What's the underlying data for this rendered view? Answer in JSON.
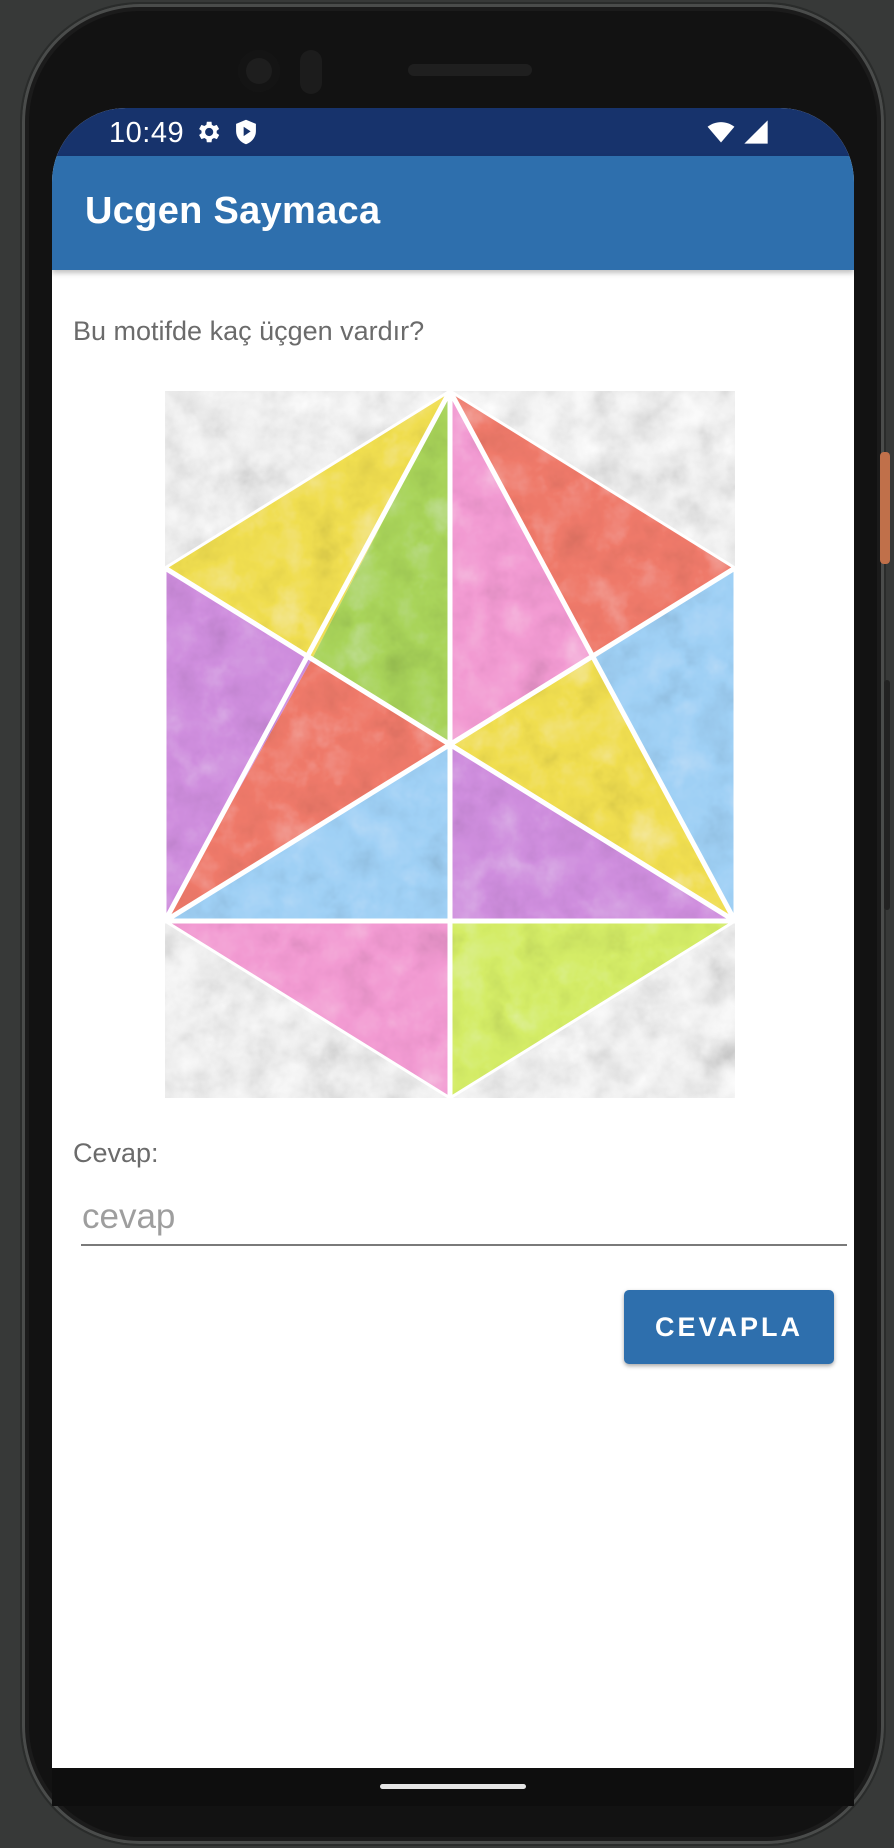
{
  "status_bar": {
    "time": "10:49",
    "left_icons": [
      "gear-icon",
      "shield-play-icon"
    ],
    "right_icons": [
      "wifi-icon",
      "cellular-signal-icon"
    ]
  },
  "app_bar": {
    "title": "Ucgen Saymaca",
    "color": "#2e6fad"
  },
  "question": {
    "text": "Bu motifde kaç üçgen vardır?"
  },
  "puzzle_image": {
    "description_colors": [
      "#f0de50",
      "#a9d45a",
      "#ef7a6a",
      "#f29ad2",
      "#9fd0f5",
      "#cf8ede",
      "#d4ec66"
    ]
  },
  "answer": {
    "label": "Cevap:",
    "placeholder": "cevap",
    "value": ""
  },
  "submit": {
    "label": "CEVAPLA"
  },
  "colors": {
    "status_bar": "#17336c",
    "accent": "#2e6fad",
    "text_secondary": "#6b6b6b"
  }
}
